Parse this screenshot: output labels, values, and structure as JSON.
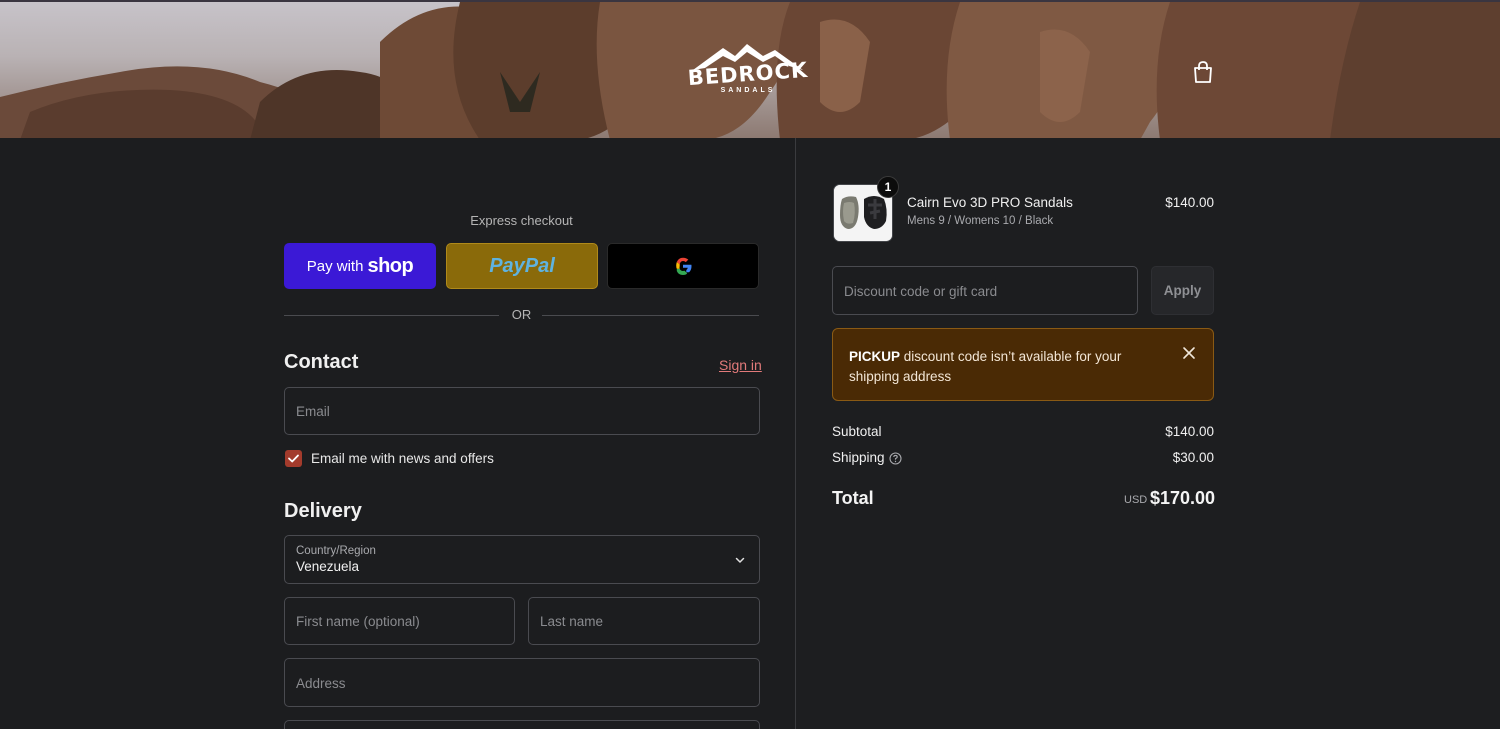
{
  "header": {
    "brand": "BEDROCK",
    "brand_sub": "SANDALS"
  },
  "express": {
    "label": "Express checkout",
    "shop_prefix": "Pay with",
    "shop_word": "shop",
    "paypal_label": "PayPal",
    "or_label": "OR"
  },
  "contact": {
    "heading": "Contact",
    "sign_in": "Sign in",
    "email_placeholder": "Email",
    "newsletter_label": "Email me with news and offers",
    "newsletter_checked": true
  },
  "delivery": {
    "heading": "Delivery",
    "country_label": "Country/Region",
    "country_value": "Venezuela",
    "first_name_placeholder": "First name (optional)",
    "last_name_placeholder": "Last name",
    "address_placeholder": "Address"
  },
  "cart": {
    "item": {
      "quantity": "1",
      "name": "Cairn Evo 3D PRO Sandals",
      "variant": "Mens 9 / Womens 10 / Black",
      "price": "$140.00"
    },
    "discount_placeholder": "Discount code or gift card",
    "apply_label": "Apply",
    "alert": {
      "code": "PICKUP",
      "message": "discount code isn’t available for your shipping address"
    },
    "subtotal_label": "Subtotal",
    "subtotal_value": "$140.00",
    "shipping_label": "Shipping",
    "shipping_value": "$30.00",
    "total_label": "Total",
    "currency": "USD",
    "total_value": "$170.00"
  },
  "colors": {
    "shop": "#3b19d6",
    "paypal": "#8a6a0a",
    "checkbox": "#a33b2c",
    "alert_bg": "#4a2a05",
    "link": "#e27a7a"
  }
}
